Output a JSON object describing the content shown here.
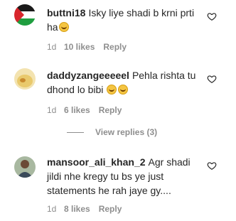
{
  "comments": [
    {
      "username": "buttni18",
      "text": "Isky liye shadi b krni prti ha",
      "emoji": "laughing-tears",
      "time": "1d",
      "likes": "10 likes",
      "reply": "Reply"
    },
    {
      "username": "daddyzangeeeeel",
      "text": "Pehla rishta tu dhond lo bibi",
      "emoji": "laughing-tears",
      "time": "1d",
      "likes": "6 likes",
      "reply": "Reply"
    },
    {
      "username": "mansoor_ali_khan_2",
      "text": "Agr shadi jildi nhe kregy tu bs ye just statements he rah jaye gy....",
      "time": "1d",
      "likes": "8 likes",
      "reply": "Reply"
    }
  ],
  "view_replies": "View replies (3)",
  "icons": {
    "like": "heart-outline-icon"
  },
  "colors": {
    "text": "#262626",
    "secondary": "#8e8e8e"
  }
}
